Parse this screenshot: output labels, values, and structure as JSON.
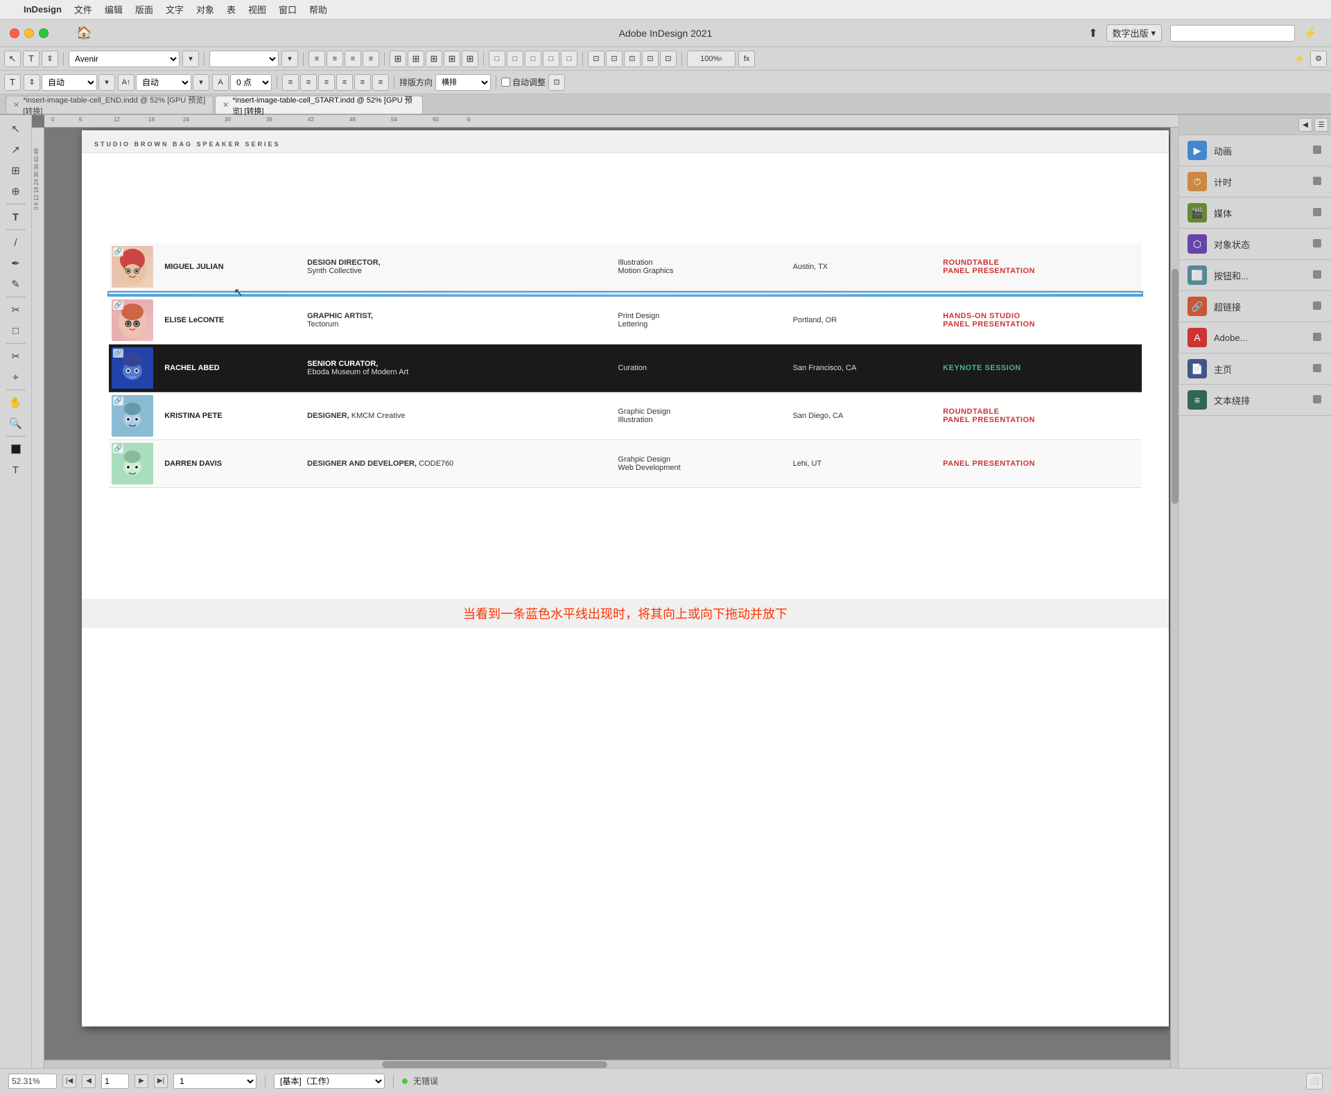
{
  "app": {
    "name": "InDesign",
    "title": "Adobe InDesign 2021",
    "apple_icon": ""
  },
  "menu": {
    "items": [
      "InDesign",
      "文件",
      "编辑",
      "版面",
      "文字",
      "对象",
      "表",
      "视图",
      "窗口",
      "帮助"
    ]
  },
  "title_bar": {
    "title": "Adobe InDesign 2021",
    "export_label": "数字出版",
    "home_icon": "🏠"
  },
  "toolbar1": {
    "font": "Avenir",
    "size": "自动",
    "points": "0 点",
    "direction_label": "排版方向",
    "direction_value": "横排",
    "auto_adjust": "自动调整",
    "zoom": "100%"
  },
  "tabs": [
    {
      "label": "*insert-image-table-cell_END.indd @ 52% [GPU 预览] [转换]",
      "active": false
    },
    {
      "label": "*insert-image-table-cell_START.indd @ 52% [GPU 预览] [转换]",
      "active": true
    }
  ],
  "document": {
    "header": "STUDIO BROWN BAG SPEAKER SERIES",
    "speakers": [
      {
        "name": "MIGUEL JULIAN",
        "job_title": "DESIGN DIRECTOR,",
        "company": "Synth Collective",
        "specialty": "Illustration\nMotion Graphics",
        "location": "Austin, TX",
        "session": "ROUNDTABLE\nPANEL PRESENTATION",
        "session_color": "red",
        "avatar_style": "miguel",
        "row_style": "normal"
      },
      {
        "name": "",
        "job_title": "",
        "company": "",
        "specialty": "",
        "location": "",
        "session": "",
        "session_color": "",
        "avatar_style": "",
        "row_style": "selected-drag"
      },
      {
        "name": "ELISE LeCONTE",
        "job_title": "GRAPHIC ARTIST,",
        "company": "Tectorum",
        "specialty": "Print Design\nLettering",
        "location": "Portland, OR",
        "session": "HANDS-ON STUDIO\nPANEL PRESENTATION",
        "session_color": "red",
        "avatar_style": "elise",
        "row_style": "light"
      },
      {
        "name": "RACHEL ABED",
        "job_title": "SENIOR CURATOR,",
        "company": "Eboda Museum of Modern Art",
        "specialty": "Curation",
        "location": "San Francisco, CA",
        "session": "KEYNOTE SESSION",
        "session_color": "keygreen",
        "avatar_style": "rachel",
        "row_style": "dark"
      },
      {
        "name": "KRISTINA PETE",
        "job_title": "DESIGNER,",
        "company": "KMCM Creative",
        "specialty": "Graphic Design\nIllustration",
        "location": "San Diego, CA",
        "session": "ROUNDTABLE\nPANEL PRESENTATION",
        "session_color": "red",
        "avatar_style": "kristina",
        "row_style": "light"
      },
      {
        "name": "DARREN DAVIS",
        "job_title": "DESIGNER AND\nDEVELOPER,",
        "company": "CODE760",
        "specialty": "Grahpic Design\nWeb Development",
        "location": "Lehi, UT",
        "session": "PANEL PRESENTATION",
        "session_color": "red",
        "avatar_style": "darren",
        "row_style": "light"
      }
    ]
  },
  "instruction": {
    "text": "当看到一条蓝色水平线出现时，将其向上或向下拖动并放下"
  },
  "right_panel": {
    "items": [
      {
        "label": "动画",
        "icon": "▶"
      },
      {
        "label": "计时",
        "icon": "⏱"
      },
      {
        "label": "媒体",
        "icon": "🎬"
      },
      {
        "label": "对象状态",
        "icon": "⬡"
      },
      {
        "label": "按钮和...",
        "icon": "⬜"
      },
      {
        "label": "超链接",
        "icon": "🔗"
      },
      {
        "label": "Adobe...",
        "icon": "A"
      },
      {
        "label": "主页",
        "icon": "📄"
      },
      {
        "label": "文本绕排",
        "icon": "≡"
      }
    ]
  },
  "status_bar": {
    "zoom": "52.31%",
    "page": "1",
    "page_label": "[基本]（工作）",
    "status": "无错误"
  },
  "tools": [
    {
      "icon": "↖",
      "name": "selection-tool"
    },
    {
      "icon": "↗",
      "name": "direct-selection-tool"
    },
    {
      "icon": "↔",
      "name": "page-tool"
    },
    {
      "icon": "⊕",
      "name": "gap-tool"
    },
    {
      "icon": "T",
      "name": "type-tool"
    },
    {
      "icon": "/",
      "name": "line-tool"
    },
    {
      "icon": "✏",
      "name": "pen-tool"
    },
    {
      "icon": "✎",
      "name": "pencil-tool"
    },
    {
      "icon": "⊗",
      "name": "scissor-tool"
    },
    {
      "icon": "□",
      "name": "rectangle-frame-tool"
    },
    {
      "icon": "✂",
      "name": "cut-tool"
    },
    {
      "icon": "⌖",
      "name": "transform-tool"
    },
    {
      "icon": "✋",
      "name": "hand-tool"
    },
    {
      "icon": "🔍",
      "name": "zoom-tool"
    },
    {
      "icon": "⬛",
      "name": "fill-tool"
    },
    {
      "icon": "T",
      "name": "text-style-tool"
    }
  ]
}
